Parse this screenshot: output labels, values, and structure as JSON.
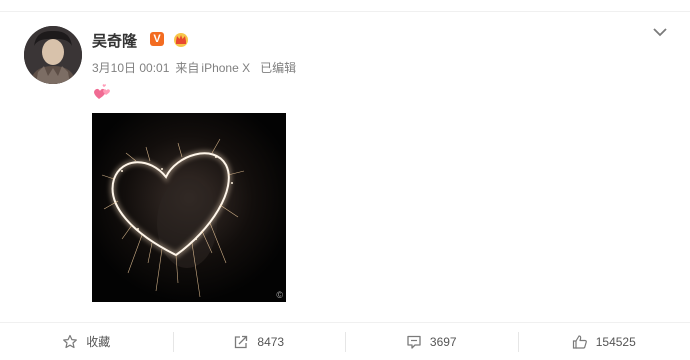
{
  "post": {
    "author": "吴奇隆",
    "verified_badge": "V",
    "date": "3月10日 00:01",
    "source_prefix": "来自",
    "device": "iPhone X",
    "edited": "已编辑",
    "image_watermark": "©"
  },
  "actions": {
    "favorite_label": "收藏",
    "repost_count": "8473",
    "comment_count": "3697",
    "like_count": "154525"
  },
  "colors": {
    "badge_orange": "#f36c21",
    "meta_gray": "#808080",
    "icon_gray": "#7a7a7a"
  },
  "icons": {
    "more": "chevron-down-icon",
    "favorite": "star-icon",
    "repost": "share-arrow-icon",
    "comment": "comment-icon",
    "like": "thumbs-up-icon",
    "emoji": "hearts-emoji-icon",
    "crown": "crown-icon"
  }
}
